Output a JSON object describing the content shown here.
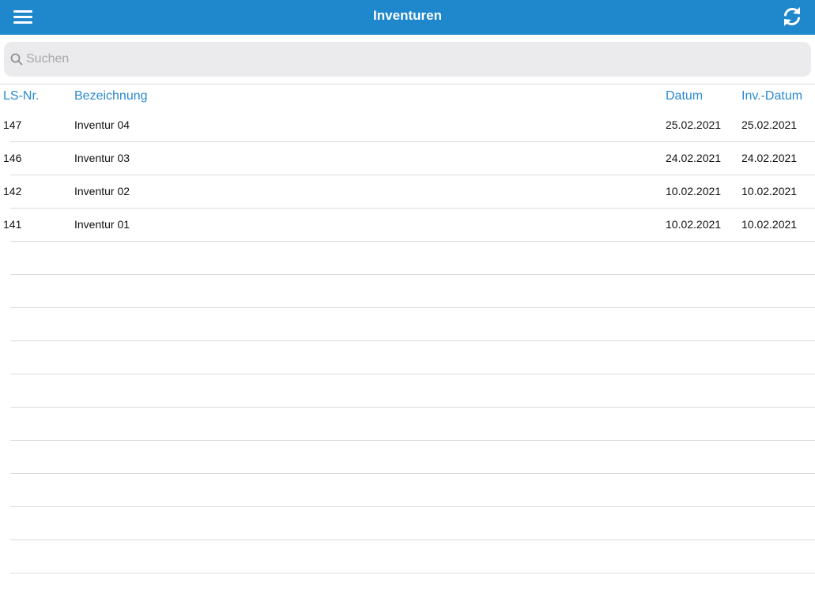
{
  "header": {
    "title": "Inventuren",
    "menu_icon": "hamburger-menu-icon",
    "refresh_icon": "refresh-icon",
    "background_color": "#1f88cc"
  },
  "search": {
    "placeholder": "Suchen",
    "value": "",
    "icon": "search-icon"
  },
  "table": {
    "columns": [
      "LS-Nr.",
      "Bezeichnung",
      "Datum",
      "Inv.-Datum"
    ],
    "header_color": "#2a8ad0",
    "rows": [
      {
        "ls_nr": "147",
        "bezeichnung": "Inventur 04",
        "datum": "25.02.2021",
        "inv_datum": "25.02.2021"
      },
      {
        "ls_nr": "146",
        "bezeichnung": "Inventur 03",
        "datum": "24.02.2021",
        "inv_datum": "24.02.2021"
      },
      {
        "ls_nr": "142",
        "bezeichnung": "Inventur 02",
        "datum": "10.02.2021",
        "inv_datum": "10.02.2021"
      },
      {
        "ls_nr": "141",
        "bezeichnung": "Inventur 01",
        "datum": "10.02.2021",
        "inv_datum": "10.02.2021"
      }
    ]
  }
}
